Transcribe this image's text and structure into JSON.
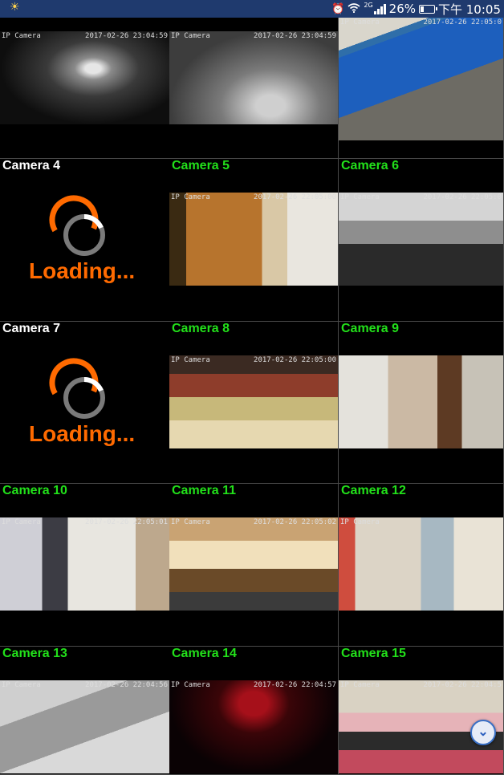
{
  "status_bar": {
    "percent": "26%",
    "time": "下午 10:05",
    "net": "2G",
    "battery_level": 0.26
  },
  "cameras": [
    {
      "label": "",
      "status": "feed",
      "watermark": "IP Camera",
      "timestamp": "2017-02-26 23:04:59",
      "scene": "dark-ir"
    },
    {
      "label": "",
      "status": "feed",
      "watermark": "IP Camera",
      "timestamp": "2017-02-26 23:04:59",
      "scene": "gray-ir"
    },
    {
      "label": "",
      "status": "feed",
      "watermark": "IP Camera",
      "timestamp": "2017-02-26 22:05:0",
      "scene": "billiards"
    },
    {
      "label": "Camera 4",
      "status": "loading",
      "loading_text": "Loading..."
    },
    {
      "label": "Camera 5",
      "status": "feed",
      "watermark": "IP Camera",
      "timestamp": "2017-02-26 22:05:00",
      "scene": "door-room"
    },
    {
      "label": "Camera 6",
      "status": "feed",
      "watermark": "IP Camera",
      "timestamp": "2017-02-26 22:05:0",
      "scene": "bw-living"
    },
    {
      "label": "Camera 7",
      "status": "loading",
      "loading_text": "Loading..."
    },
    {
      "label": "Camera 8",
      "status": "feed",
      "watermark": "IP Camera",
      "timestamp": "2017-02-26 22:05:00",
      "scene": "tv-room"
    },
    {
      "label": "Camera 9",
      "status": "feed",
      "watermark": "",
      "timestamp": "",
      "scene": "dining"
    },
    {
      "label": "Camera 10",
      "status": "feed",
      "watermark": "IP Camera",
      "timestamp": "2017-02-26 22:05:01",
      "scene": "bedroom"
    },
    {
      "label": "Camera 11",
      "status": "feed",
      "watermark": "IP Camera",
      "timestamp": "2017-02-26 22:05:02",
      "scene": "living-warm"
    },
    {
      "label": "Camera 12",
      "status": "feed",
      "watermark": "IP Camera",
      "timestamp": "",
      "scene": "family"
    },
    {
      "label": "Camera 13",
      "status": "feed",
      "watermark": "IP Camera",
      "timestamp": "2017-02-26 22:04:56",
      "scene": "gray-room"
    },
    {
      "label": "Camera 14",
      "status": "feed",
      "watermark": "IP Camera",
      "timestamp": "2017-02-26 22:04:57",
      "scene": "red-dark"
    },
    {
      "label": "Camera 15",
      "status": "feed",
      "watermark": "IP Camera",
      "timestamp": "2017-02-26 22:04:5",
      "scene": "kids-room"
    }
  ],
  "colors": {
    "label_active": "#22e01a",
    "label_loading": "#ffffff",
    "loading_orange": "#ff6a00",
    "status_bar_bg": "#1f3a6e"
  },
  "icons": {
    "scroll_button": "chevron-down-icon",
    "status_left": "sun-icon"
  }
}
